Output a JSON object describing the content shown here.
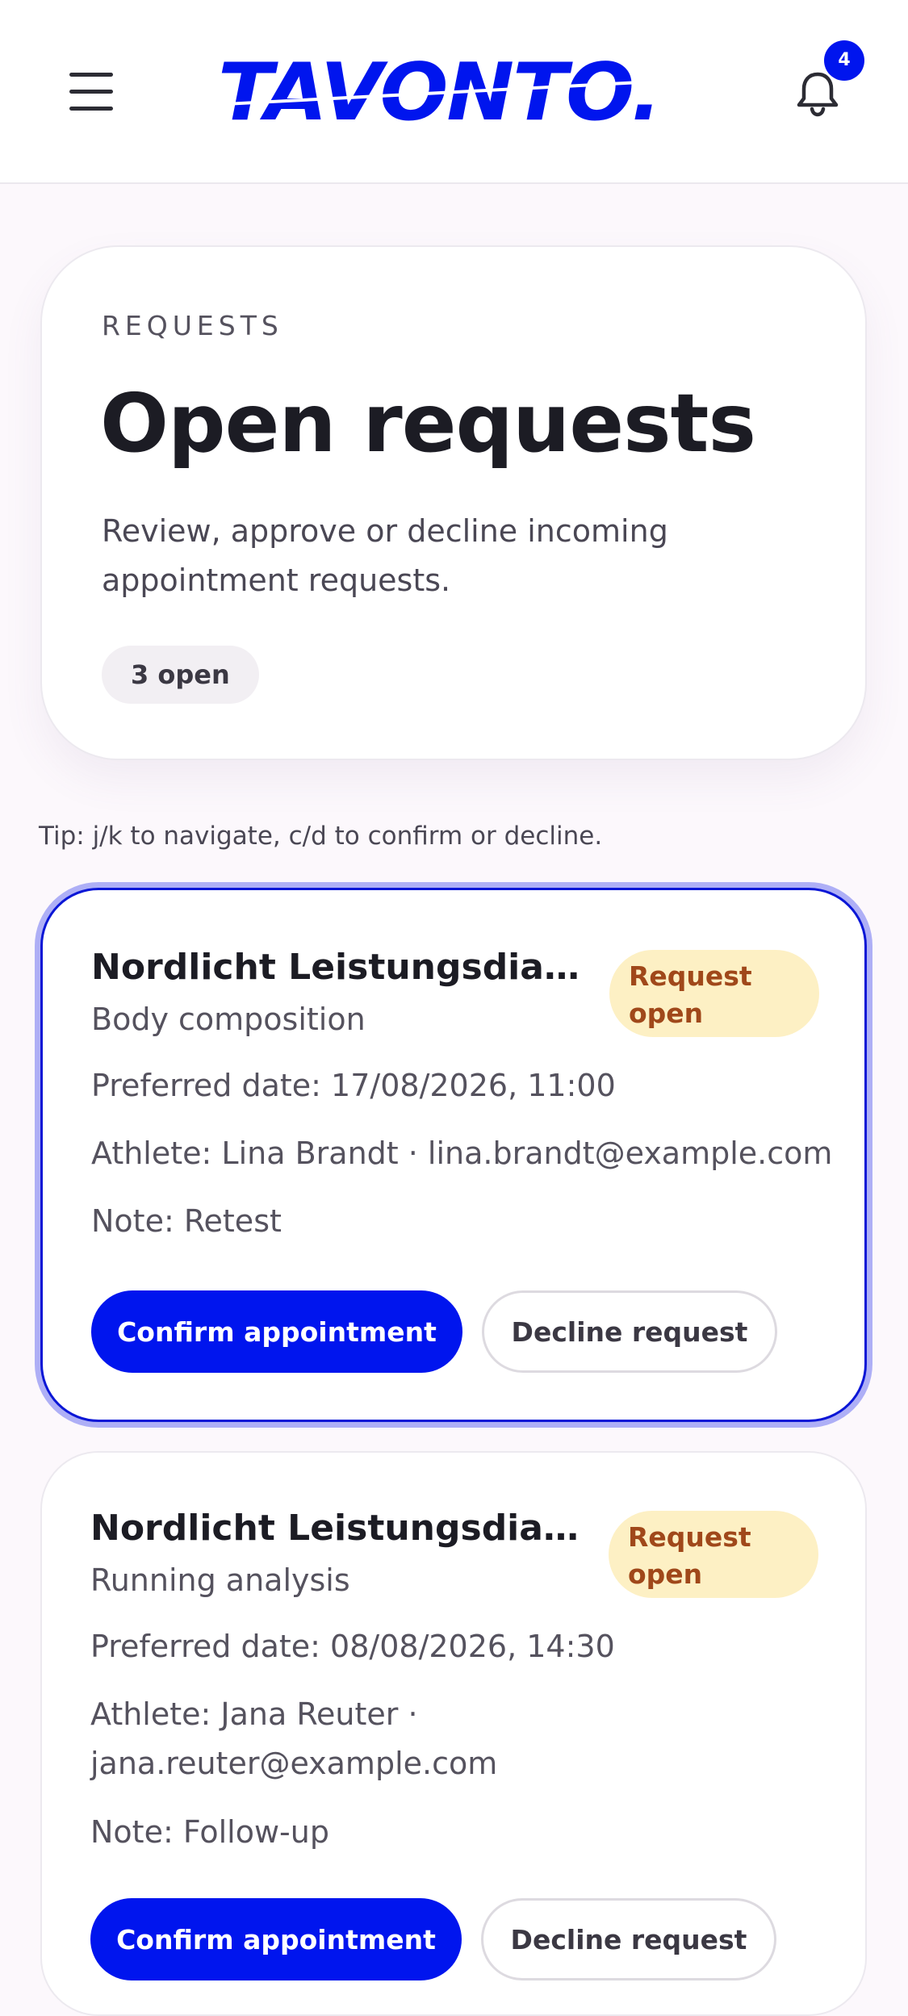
{
  "header": {
    "brand": "TAVONTO.",
    "notification_count": "4"
  },
  "hero": {
    "eyebrow": "REQUESTS",
    "title": "Open requests",
    "subtitle": "Review, approve or decline incoming appointment requests.",
    "count_label": "3 open"
  },
  "tip": "Tip: j/k to navigate, c/d to confirm or decline.",
  "requests": [
    {
      "provider": "Nordlicht Leistungsdiagnostik",
      "service": "Body composition",
      "status": "Request open",
      "preferred_date": "Preferred date: 17/08/2026, 11:00",
      "athlete": "Athlete: Lina Brandt · lina.brandt@example.com",
      "note": "Note: Retest",
      "confirm_label": "Confirm appointment",
      "decline_label": "Decline request"
    },
    {
      "provider": "Nordlicht Leistungsdiagnostik",
      "service": "Running analysis",
      "status": "Request open",
      "preferred_date": "Preferred date: 08/08/2026, 14:30",
      "athlete": "Athlete: Jana Reuter · jana.reuter@example.com",
      "note": "Note: Follow-up",
      "confirm_label": "Confirm appointment",
      "decline_label": "Decline request"
    }
  ],
  "colors": {
    "brand": "#0015ee",
    "badge_bg": "#fdf0c4",
    "badge_text": "#a0481a"
  },
  "icons": [
    "menu-icon",
    "bell-icon"
  ]
}
